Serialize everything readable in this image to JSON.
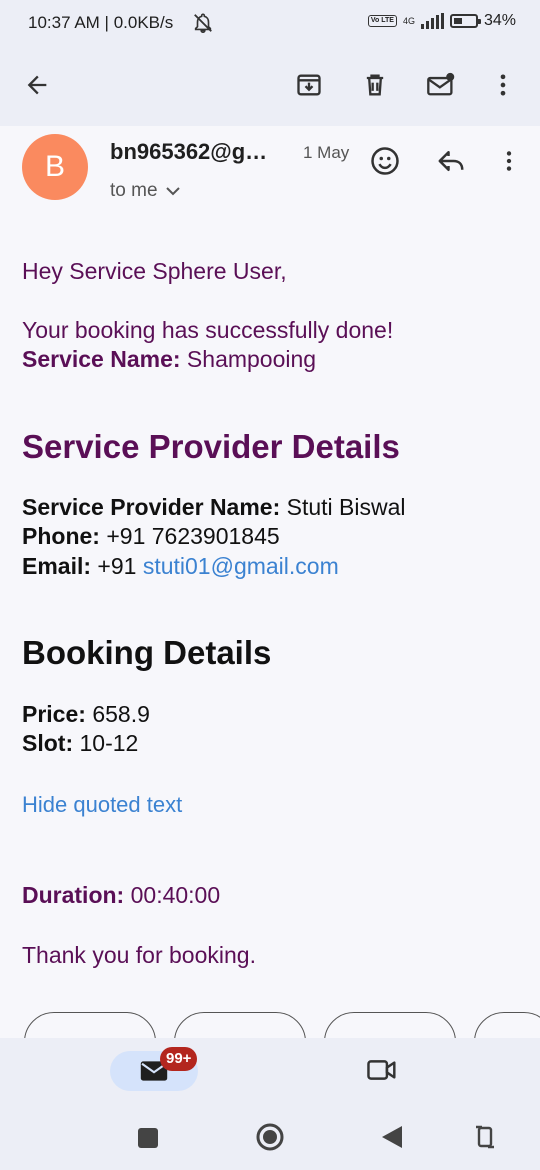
{
  "status_bar": {
    "time_speed": "10:37 AM | 0.0KB/s",
    "volte": "Vo LTE",
    "network": "4G",
    "battery": "34%"
  },
  "email": {
    "avatar_letter": "B",
    "sender": "bn965362@g…",
    "date": "1 May",
    "recipient": "to me"
  },
  "body": {
    "greeting": "Hey Service Sphere User,",
    "success": "Your booking has successfully done!",
    "service_label": "Service Name:",
    "service_value": " Shampooing",
    "provider_heading": "Service Provider Details",
    "provider_name_label": "Service Provider Name:",
    "provider_name_value": " Stuti Biswal",
    "phone_label": "Phone:",
    "phone_value": " +91 7623901845",
    "email_label": "Email:",
    "email_prefix": " +91 ",
    "email_link": "stuti01@gmail.com",
    "booking_heading": "Booking Details",
    "price_label": "Price:",
    "price_value": " 658.9",
    "slot_label": "Slot:",
    "slot_value": " 10-12",
    "hide_quoted": "Hide quoted text",
    "duration_label": "Duration:",
    "duration_value": " 00:40:00",
    "thanks": "Thank you for booking."
  },
  "bottom_nav": {
    "mail_badge": "99+"
  },
  "colors": {
    "accent_purple": "#5a0f56",
    "link": "#3b82d1",
    "avatar": "#fa8a5f",
    "badge": "#b3261e"
  }
}
